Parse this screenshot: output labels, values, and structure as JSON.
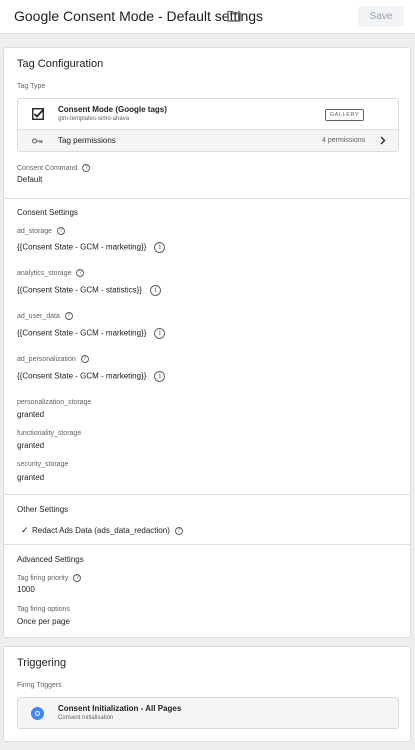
{
  "header": {
    "title": "Google Consent Mode - Default settings",
    "folder_icon": "folder-icon",
    "save_label": "Save"
  },
  "tag_configuration": {
    "heading": "Tag Configuration",
    "tag_type_label": "Tag Type",
    "tag": {
      "icon": "checkbox-checked-icon",
      "name": "Consent Mode (Google tags)",
      "source": "gtm-templates-simo-ahava",
      "gallery_label": "GALLERY",
      "permissions_icon": "key-icon",
      "permissions_label": "Tag permissions",
      "permissions_count": "4 permissions"
    },
    "consent_command": {
      "label": "Consent Command",
      "value": "Default"
    },
    "consent_settings": {
      "title": "Consent Settings",
      "fields": [
        {
          "label": "ad_storage",
          "value": "{{Consent State - GCM - marketing}}"
        },
        {
          "label": "analytics_storage",
          "value": "{{Consent State - GCM - statistics}}"
        },
        {
          "label": "ad_user_data",
          "value": "{{Consent State - GCM - marketing}}"
        },
        {
          "label": "ad_personalization",
          "value": "{{Consent State - GCM - marketing}}"
        }
      ],
      "plain_fields": [
        {
          "label": "personalization_storage",
          "value": "granted"
        },
        {
          "label": "functionality_storage",
          "value": "granted"
        },
        {
          "label": "security_storage",
          "value": "granted"
        }
      ]
    },
    "other_settings": {
      "title": "Other Settings",
      "redact_label": "Redact Ads Data (ads_data_redaction)",
      "redact_checked": true
    },
    "advanced_settings": {
      "title": "Advanced Settings",
      "priority_label": "Tag firing priority",
      "priority_value": "1000",
      "options_label": "Tag firing options",
      "options_value": "Once per page"
    }
  },
  "triggering": {
    "heading": "Triggering",
    "firing_label": "Firing Triggers",
    "trigger": {
      "icon": "initialization-trigger-icon",
      "color": "#4285f4",
      "name": "Consent Initialization - All Pages",
      "type": "Consent Initialisation"
    }
  }
}
